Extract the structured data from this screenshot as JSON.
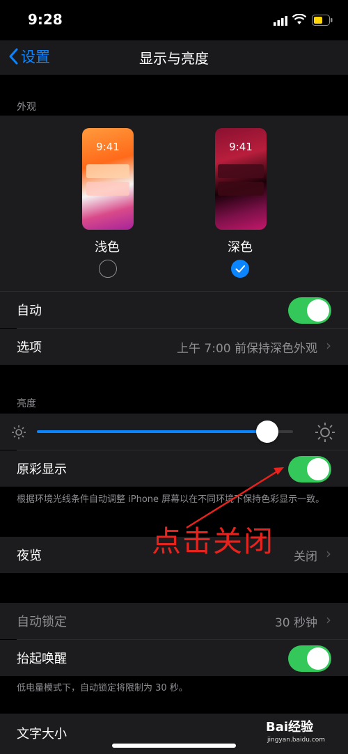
{
  "status": {
    "time": "9:28"
  },
  "nav": {
    "back_label": "设置",
    "title": "显示与亮度"
  },
  "appearance": {
    "header": "外观",
    "light": {
      "label": "浅色",
      "preview_time": "9:41",
      "selected": false
    },
    "dark": {
      "label": "深色",
      "preview_time": "9:41",
      "selected": true
    },
    "auto_label": "自动",
    "auto_on": true,
    "options_label": "选项",
    "options_value": "上午 7:00 前保持深色外观"
  },
  "brightness": {
    "header": "亮度",
    "level": 0.9,
    "true_tone_label": "原彩显示",
    "true_tone_on": true,
    "note": "根据环境光线条件自动调整 iPhone 屏幕以在不同环境下保持色彩显示一致。"
  },
  "night_shift": {
    "label": "夜览",
    "value": "关闭"
  },
  "auto_lock": {
    "label": "自动锁定",
    "value": "30 秒钟"
  },
  "raise_to_wake": {
    "label": "抬起唤醒",
    "on": true
  },
  "low_power_note": "低电量模式下，自动锁定将限制为 30 秒。",
  "text_size": {
    "label": "文字大小"
  },
  "annotation": "点击关闭",
  "watermark": {
    "brand": "Bai经验",
    "site": "jingyan.baidu.com"
  },
  "colors": {
    "accent": "#0a84ff",
    "toggle_on": "#34c759",
    "annotation": "#e8231e"
  }
}
